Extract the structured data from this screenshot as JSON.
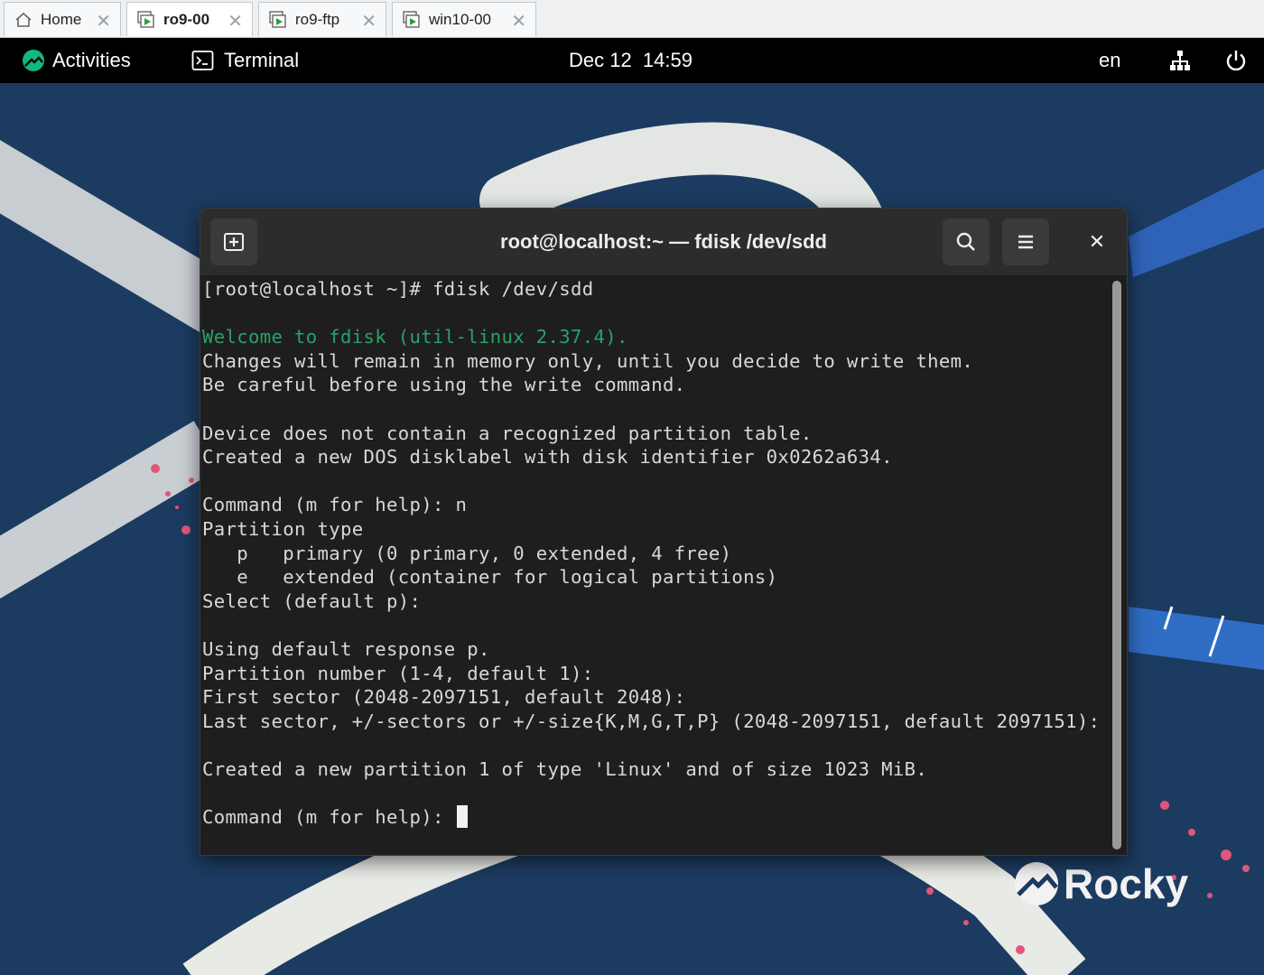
{
  "vm_tabs": [
    {
      "label": "Home",
      "icon": "home-icon",
      "active": false
    },
    {
      "label": "ro9-00",
      "icon": "vm-running-icon",
      "active": true
    },
    {
      "label": "ro9-ftp",
      "icon": "vm-running-icon",
      "active": false
    },
    {
      "label": "win10-00",
      "icon": "vm-running-icon",
      "active": false
    }
  ],
  "topbar": {
    "activities": "Activities",
    "app_name": "Terminal",
    "clock": "Dec 12  14:59",
    "lang": "en",
    "network_icon": "network-icon",
    "power_icon": "power-icon"
  },
  "terminal": {
    "title": "root@localhost:~ — fdisk /dev/sdd",
    "lines": [
      {
        "text": "[root@localhost ~]# fdisk /dev/sdd",
        "style": "normal"
      },
      {
        "text": "",
        "style": "normal"
      },
      {
        "text": "Welcome to fdisk (util-linux 2.37.4).",
        "style": "green"
      },
      {
        "text": "Changes will remain in memory only, until you decide to write them.",
        "style": "normal"
      },
      {
        "text": "Be careful before using the write command.",
        "style": "normal"
      },
      {
        "text": "",
        "style": "normal"
      },
      {
        "text": "Device does not contain a recognized partition table.",
        "style": "normal"
      },
      {
        "text": "Created a new DOS disklabel with disk identifier 0x0262a634.",
        "style": "normal"
      },
      {
        "text": "",
        "style": "normal"
      },
      {
        "text": "Command (m for help): n",
        "style": "normal"
      },
      {
        "text": "Partition type",
        "style": "normal"
      },
      {
        "text": "   p   primary (0 primary, 0 extended, 4 free)",
        "style": "normal"
      },
      {
        "text": "   e   extended (container for logical partitions)",
        "style": "normal"
      },
      {
        "text": "Select (default p):",
        "style": "normal"
      },
      {
        "text": "",
        "style": "normal"
      },
      {
        "text": "Using default response p.",
        "style": "normal"
      },
      {
        "text": "Partition number (1-4, default 1):",
        "style": "normal"
      },
      {
        "text": "First sector (2048-2097151, default 2048):",
        "style": "normal"
      },
      {
        "text": "Last sector, +/-sectors or +/-size{K,M,G,T,P} (2048-2097151, default 2097151):",
        "style": "normal"
      },
      {
        "text": "",
        "style": "normal"
      },
      {
        "text": "Created a new partition 1 of type 'Linux' and of size 1023 MiB.",
        "style": "normal"
      },
      {
        "text": "",
        "style": "normal"
      }
    ],
    "prompt": "Command (m for help): "
  },
  "wallpaper": {
    "logo_text": "Rocky"
  },
  "colors": {
    "desktop_bg": "#1c3b60",
    "terminal_bg": "#1e1e1e",
    "terminal_header": "#2c2c2c",
    "fdisk_green": "#26a269",
    "rocky_green": "#10b981"
  }
}
